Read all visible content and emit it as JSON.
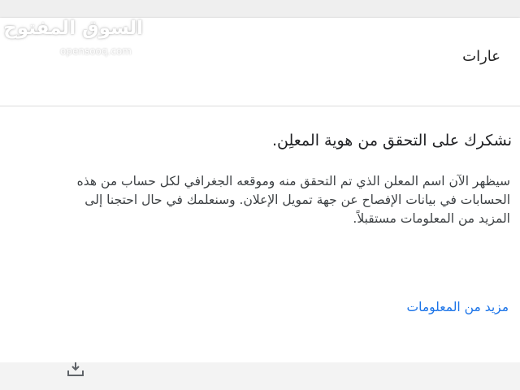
{
  "watermark": {
    "logo_text": "السوق المفتوح",
    "domain": "opensooq.com"
  },
  "dialog": {
    "header_title": "عارات",
    "heading": "نشكرك على التحقق من هوية المعلِن.",
    "body": "سيظهر الآن اسم المعلن الذي تم التحقق منه وموقعه الجغرافي لكل حساب من هذه الحسابات في بيانات الإفصاح عن جهة تمويل الإعلان. وسنعلمك في حال احتجنا إلى المزيد من المعلومات مستقبلاً.",
    "more_info_link": "مزيد من المعلومات"
  },
  "icons": {
    "download": "download-icon"
  },
  "colors": {
    "link": "#1a73e8",
    "heading_text": "#202124",
    "body_text": "#3c4043",
    "divider": "#dcdcdc"
  }
}
